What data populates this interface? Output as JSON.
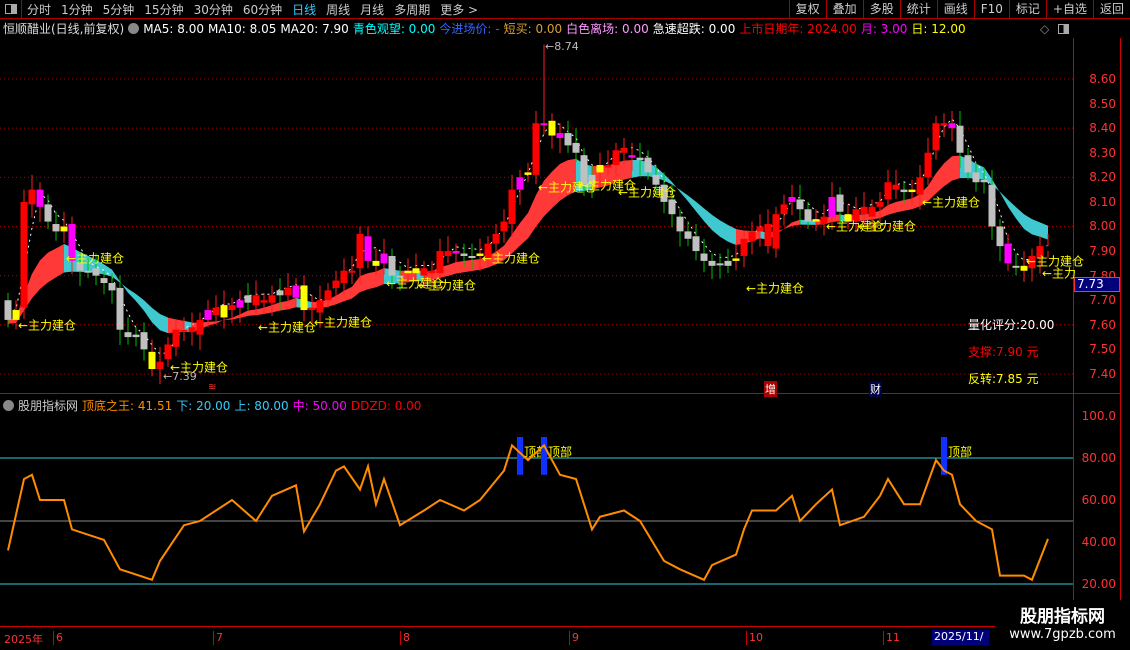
{
  "toolbar": {
    "periods": [
      "分时",
      "1分钟",
      "5分钟",
      "15分钟",
      "30分钟",
      "60分钟",
      "日线",
      "周线",
      "月线",
      "多周期",
      "更多 >"
    ],
    "active": "日线",
    "buttons": [
      "复权",
      "叠加",
      "多股",
      "统计",
      "画线",
      "F10",
      "标记",
      "+自选",
      "返回"
    ]
  },
  "header": {
    "title": "恒顺醋业(日线,前复权)",
    "ma5": "MA5: 8.00",
    "ma10": "MA10: 8.05",
    "ma20": "MA20: 7.90",
    "qingse": "青色观望: 0.00",
    "jinchang": "今进场价: -",
    "duanmai": "短买: 0.00",
    "baise": "白色离场: 0.00",
    "jisu": "急速超跌: 0.00",
    "ssrq_nian": "上市日期年: 2024.00",
    "yue": "月: 3.00",
    "ri": "日: 12.00"
  },
  "lower_header": {
    "title": "股朋指标网",
    "ddzw": "顶底之王: 41.51",
    "xia": "下: 20.00",
    "shang": "上: 80.00",
    "zhong": "中: 50.00",
    "ddzd": "DDZD: 0.00"
  },
  "price_axis": [
    "8.60",
    "8.50",
    "8.40",
    "8.30",
    "8.20",
    "8.10",
    "8.00",
    "7.90",
    "7.80",
    "7.70",
    "7.60",
    "7.50",
    "7.40"
  ],
  "last_price": "7.73",
  "osc_axis": [
    "100.0",
    "80.00",
    "60.00",
    "40.00",
    "20.00"
  ],
  "quant": {
    "score": "量化评分:20.00",
    "support": "支撑:7.90 元",
    "reversal": "反转:7.85 元"
  },
  "extremes": {
    "high": "8.74",
    "low": "7.39"
  },
  "markers": {
    "zeng": "增",
    "cai": "财",
    "top_label": "顶部"
  },
  "dates": [
    "2025年",
    "6",
    "7",
    "8",
    "9",
    "10",
    "11",
    "2025/11/"
  ],
  "watermark": {
    "name": "股朋指标网",
    "url": "www.7gpzb.com"
  },
  "colors": {
    "up": "#ff0000",
    "down": "#c0c0c0",
    "yellow": "#ffff00",
    "magenta": "#ff00ff",
    "cyan": "#40c8d0",
    "osc": "#ff8c00"
  },
  "chart_data": {
    "type": "candlestick",
    "closes": [
      7.62,
      7.66,
      8.1,
      8.15,
      8.08,
      8.02,
      7.98,
      8.0,
      7.86,
      7.82,
      7.82,
      7.8,
      7.77,
      7.74,
      7.58,
      7.55,
      7.56,
      7.5,
      7.42,
      7.45,
      7.52,
      7.58,
      7.58,
      7.57,
      7.62,
      7.66,
      7.64,
      7.68,
      7.66,
      7.7,
      7.72,
      7.68,
      7.7,
      7.72,
      7.74,
      7.72,
      7.76,
      7.66,
      7.66,
      7.7,
      7.74,
      7.78,
      7.82,
      7.82,
      7.97,
      7.86,
      7.84,
      7.89,
      7.8,
      7.8,
      7.82,
      7.83,
      7.8,
      7.82,
      7.9,
      7.88,
      7.9,
      7.88,
      7.88,
      7.88,
      7.93,
      7.97,
      8.02,
      8.15,
      8.2,
      8.22,
      8.42,
      8.42,
      8.37,
      8.38,
      8.33,
      8.3,
      8.17,
      8.21,
      8.25,
      8.25,
      8.31,
      8.3,
      8.28,
      8.27,
      8.22,
      8.17,
      8.1,
      8.05,
      7.98,
      7.95,
      7.9,
      7.86,
      7.84,
      7.85,
      7.86,
      7.87,
      7.95,
      7.98,
      8.0,
      7.92,
      8.05,
      8.09,
      8.12,
      8.07,
      8.02,
      8.02,
      8.04,
      8.12,
      8.06,
      8.02,
      8.07,
      8.05,
      8.08,
      8.1,
      8.18,
      8.15,
      8.14,
      8.14,
      8.2,
      8.3,
      8.42,
      8.42,
      8.4,
      8.3,
      8.22,
      8.18,
      8.18,
      8.0,
      7.92,
      7.85,
      7.84,
      7.82,
      7.88,
      7.92,
      7.9
    ],
    "candle_colors": "gyrrmggymgggggggggyrrrrrrmryrmgrrrgrmyrrrrrrrmymggyyrrrrmggyrrrrmyrmymggggyrrrmggggggggggggyrrrrrrmggyrmgyrrrrrrgyrrrrmggggggmgyrr",
    "high_index": 67,
    "high_value": 8.74,
    "low_index": 18,
    "low_value": 7.39,
    "annotations": {
      "text": "←主力建仓",
      "short_text": "←主力",
      "points": [
        [
          1,
          7.6
        ],
        [
          7,
          7.87
        ],
        [
          20,
          7.43
        ],
        [
          31,
          7.59
        ],
        [
          38,
          7.61
        ],
        [
          47,
          7.77
        ],
        [
          51,
          7.76
        ],
        [
          59,
          7.87
        ],
        [
          66,
          8.16
        ],
        [
          71,
          8.17
        ],
        [
          76,
          8.14
        ],
        [
          92,
          7.75
        ],
        [
          102,
          8.0
        ],
        [
          106,
          8.0
        ],
        [
          114,
          8.1
        ],
        [
          127,
          7.86
        ]
      ],
      "short_point": [
        129,
        7.81
      ]
    },
    "ylim": [
      7.35,
      8.75
    ],
    "oscillator": {
      "name": "顶底之王",
      "ylim": [
        10,
        105
      ],
      "lines": {
        "upper": 80,
        "middle": 50,
        "lower": 20
      },
      "points": [
        [
          0,
          36
        ],
        [
          2,
          70
        ],
        [
          3,
          72
        ],
        [
          4,
          60
        ],
        [
          7,
          60
        ],
        [
          8,
          46
        ],
        [
          12,
          41
        ],
        [
          14,
          27
        ],
        [
          18,
          22
        ],
        [
          19,
          31
        ],
        [
          22,
          48
        ],
        [
          24,
          50
        ],
        [
          28,
          60
        ],
        [
          31,
          50
        ],
        [
          33,
          62
        ],
        [
          36,
          67
        ],
        [
          37,
          45
        ],
        [
          39,
          58
        ],
        [
          41,
          74
        ],
        [
          42,
          76
        ],
        [
          44,
          65
        ],
        [
          45,
          76
        ],
        [
          46,
          58
        ],
        [
          47,
          70
        ],
        [
          49,
          48
        ],
        [
          52,
          55
        ],
        [
          54,
          60
        ],
        [
          57,
          55
        ],
        [
          59,
          60
        ],
        [
          62,
          74
        ],
        [
          63,
          86
        ],
        [
          65,
          79
        ],
        [
          67,
          86
        ],
        [
          69,
          72
        ],
        [
          71,
          70
        ],
        [
          73,
          46
        ],
        [
          74,
          52
        ],
        [
          77,
          55
        ],
        [
          79,
          50
        ],
        [
          82,
          31
        ],
        [
          84,
          27
        ],
        [
          87,
          22
        ],
        [
          88,
          29
        ],
        [
          91,
          34
        ],
        [
          92,
          46
        ],
        [
          93,
          55
        ],
        [
          96,
          55
        ],
        [
          98,
          62
        ],
        [
          99,
          50
        ],
        [
          101,
          58
        ],
        [
          103,
          65
        ],
        [
          104,
          48
        ],
        [
          107,
          52
        ],
        [
          109,
          62
        ],
        [
          110,
          70
        ],
        [
          112,
          58
        ],
        [
          114,
          58
        ],
        [
          116,
          79
        ],
        [
          117,
          74
        ],
        [
          118,
          72
        ],
        [
          119,
          58
        ],
        [
          121,
          50
        ],
        [
          123,
          46
        ],
        [
          124,
          24
        ],
        [
          127,
          24
        ],
        [
          128,
          22
        ],
        [
          130,
          41.51
        ]
      ],
      "top_signals": [
        64,
        67,
        117
      ]
    }
  }
}
